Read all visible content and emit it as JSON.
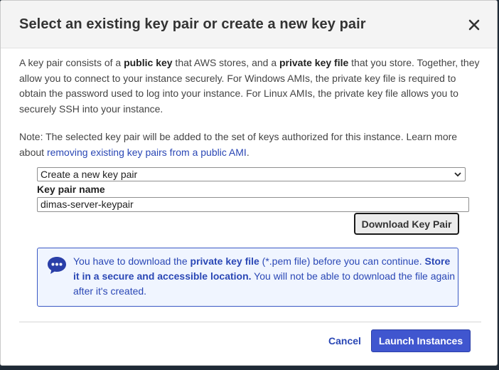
{
  "dialog": {
    "title": "Select an existing key pair or create a new key pair"
  },
  "description": {
    "p1": "A key pair consists of a ",
    "public_key": "public key",
    "p2": " that AWS stores, and a ",
    "private_key_file": "private key file",
    "p3": " that you store. Together, they allow you to connect to your instance securely. For Windows AMIs, the private key file is required to obtain the password used to log into your instance. For Linux AMIs, the private key file allows you to securely SSH into your instance."
  },
  "note": {
    "text": "Note: The selected key pair will be added to the set of keys authorized for this instance. Learn more about ",
    "link": "removing existing key pairs from a public AMI",
    "end": "."
  },
  "key_pair_select": {
    "selected": "Create a new key pair"
  },
  "key_pair_name": {
    "label": "Key pair name",
    "value": "dimas-server-keypair"
  },
  "download_button": "Download Key Pair",
  "info": {
    "t1": "You have to download the ",
    "private_key_file": "private key file",
    "t2": " (*.pem file) before you can continue. ",
    "store": "Store it in a secure and accessible location.",
    "t3": " You will not be able to download the file again after it's created.",
    "icon": "chat-bubble-icon"
  },
  "footer": {
    "cancel": "Cancel",
    "launch": "Launch Instances"
  },
  "colors": {
    "link": "#2a47b5",
    "primary_button": "#4056cf",
    "info_background": "#f0f5ff"
  }
}
